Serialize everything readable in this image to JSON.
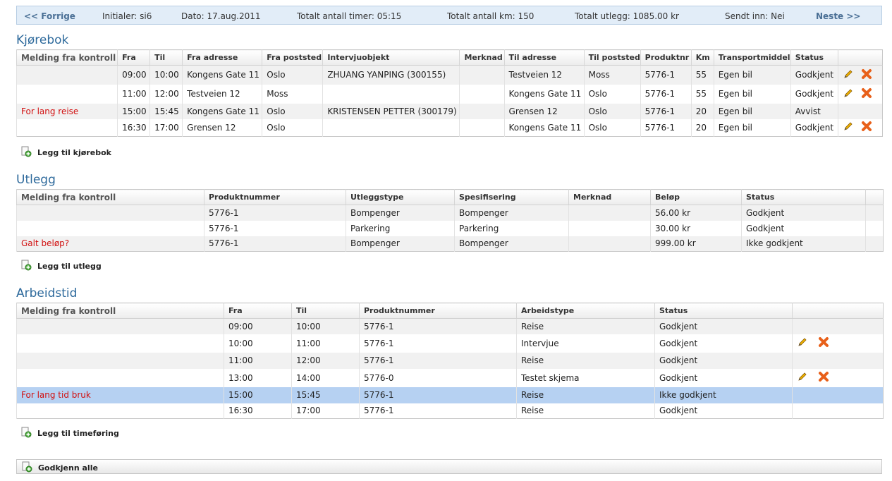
{
  "topbar": {
    "prev": "<< Forrige",
    "initials": "Initialer: si6",
    "date": "Dato: 17.aug.2011",
    "total_hours": "Totalt antall timer: 05:15",
    "total_km": "Totalt antall km: 150",
    "total_expenses": "Totalt utlegg: 1085.00 kr",
    "submitted": "Sendt inn: Nei",
    "next": "Neste >>"
  },
  "kjorebok": {
    "title": "Kjørebok",
    "headers": [
      "Melding fra kontroll",
      "Fra",
      "Til",
      "Fra adresse",
      "Fra poststed",
      "Intervjuobjekt",
      "Merknad",
      "Til adresse",
      "Til poststed",
      "Produktnr",
      "Km",
      "Transportmiddel",
      "Status"
    ],
    "rows": [
      {
        "msg": "",
        "from": "09:00",
        "to": "10:00",
        "from_addr": "Kongens Gate 11",
        "from_place": "Oslo",
        "object": "ZHUANG YANPING (300155)",
        "note": "",
        "to_addr": "Testveien 12",
        "to_place": "Moss",
        "product": "5776-1",
        "km": "55",
        "transport": "Egen bil",
        "status": "Godkjent"
      },
      {
        "msg": "",
        "from": "11:00",
        "to": "12:00",
        "from_addr": "Testveien 12",
        "from_place": "Moss",
        "object": "",
        "note": "",
        "to_addr": "Kongens Gate 11",
        "to_place": "Oslo",
        "product": "5776-1",
        "km": "55",
        "transport": "Egen bil",
        "status": "Godkjent"
      },
      {
        "msg": "For lang reise",
        "from": "15:00",
        "to": "15:45",
        "from_addr": "Kongens Gate 11",
        "from_place": "Oslo",
        "object": "KRISTENSEN PETTER (300179)",
        "note": "",
        "to_addr": "Grensen 12",
        "to_place": "Oslo",
        "product": "5776-1",
        "km": "20",
        "transport": "Egen bil",
        "status": "Avvist"
      },
      {
        "msg": "",
        "from": "16:30",
        "to": "17:00",
        "from_addr": "Grensen 12",
        "from_place": "Oslo",
        "object": "",
        "note": "",
        "to_addr": "Kongens Gate 11",
        "to_place": "Oslo",
        "product": "5776-1",
        "km": "20",
        "transport": "Egen bil",
        "status": "Godkjent"
      }
    ],
    "add_label": "Legg til kjørebok"
  },
  "utlegg": {
    "title": "Utlegg",
    "headers": [
      "Melding fra kontroll",
      "Produktnummer",
      "Utleggstype",
      "Spesifisering",
      "Merknad",
      "Beløp",
      "Status"
    ],
    "rows": [
      {
        "msg": "",
        "product": "5776-1",
        "type": "Bompenger",
        "spec": "Bompenger",
        "note": "",
        "amount": "56.00 kr",
        "status": "Godkjent"
      },
      {
        "msg": "",
        "product": "5776-1",
        "type": "Parkering",
        "spec": "Parkering",
        "note": "",
        "amount": "30.00 kr",
        "status": "Godkjent"
      },
      {
        "msg": "Galt beløp?",
        "product": "5776-1",
        "type": "Bompenger",
        "spec": "Bompenger",
        "note": "",
        "amount": "999.00 kr",
        "status": "Ikke godkjent"
      }
    ],
    "add_label": "Legg til utlegg"
  },
  "arbeidstid": {
    "title": "Arbeidstid",
    "headers": [
      "Melding fra kontroll",
      "Fra",
      "Til",
      "Produktnummer",
      "Arbeidstype",
      "Status"
    ],
    "rows": [
      {
        "msg": "",
        "from": "09:00",
        "to": "10:00",
        "product": "5776-1",
        "type": "Reise",
        "status": "Godkjent"
      },
      {
        "msg": "",
        "from": "10:00",
        "to": "11:00",
        "product": "5776-1",
        "type": "Intervjue",
        "status": "Godkjent"
      },
      {
        "msg": "",
        "from": "11:00",
        "to": "12:00",
        "product": "5776-1",
        "type": "Reise",
        "status": "Godkjent"
      },
      {
        "msg": "",
        "from": "13:00",
        "to": "14:00",
        "product": "5776-0",
        "type": "Testet skjema",
        "status": "Godkjent"
      },
      {
        "msg": "For lang tid bruk",
        "from": "15:00",
        "to": "15:45",
        "product": "5776-1",
        "type": "Reise",
        "status": "Ikke godkjent"
      },
      {
        "msg": "",
        "from": "16:30",
        "to": "17:00",
        "product": "5776-1",
        "type": "Reise",
        "status": "Godkjent"
      }
    ],
    "add_label": "Legg til timeføring"
  },
  "approve_all_label": "Godkjenn alle",
  "colors": {
    "accent_title": "#2e6a9c",
    "error_text": "#d10f0f",
    "selected_row": "#b6d1f2"
  },
  "icons": {
    "edit": "pencil-icon",
    "delete": "delete-x-icon",
    "add": "add-document-icon"
  }
}
